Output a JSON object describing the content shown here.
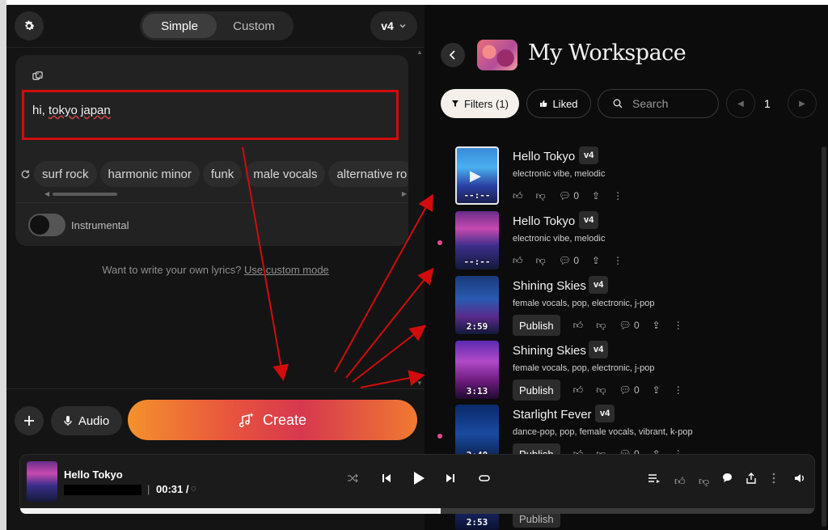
{
  "header": {
    "mode_simple": "Simple",
    "mode_custom": "Custom",
    "version": "v4"
  },
  "prompt": {
    "text_prefix": "hi, ",
    "text_word": "tokyo japan",
    "tags": [
      "surf rock",
      "harmonic minor",
      "funk",
      "male vocals",
      "alternative ro"
    ],
    "instrumental_label": "Instrumental",
    "instrumental_on": false,
    "lyrics_hint": "Want to write your own lyrics?",
    "lyrics_link": "Use custom mode"
  },
  "bottom_bar": {
    "audio_label": "Audio",
    "create_label": "Create"
  },
  "workspace": {
    "title": "My Workspace",
    "filters_label": "Filters (1)",
    "liked_label": "Liked",
    "search_placeholder": "Search",
    "page": "1"
  },
  "songs": [
    {
      "title": "Hello Tokyo",
      "version": "v4",
      "tags": "electronic vibe, melodic",
      "duration": "--:--",
      "comments": "0",
      "publish": "",
      "selected": true,
      "new": false
    },
    {
      "title": "Hello Tokyo",
      "version": "v4",
      "tags": "electronic vibe, melodic",
      "duration": "--:--",
      "comments": "0",
      "publish": "",
      "selected": false,
      "new": true
    },
    {
      "title": "Shining Skies",
      "version": "v4",
      "tags": "female vocals, pop, electronic, j-pop",
      "duration": "2:59",
      "comments": "0",
      "publish": "Publish",
      "selected": false,
      "new": false
    },
    {
      "title": "Shining Skies",
      "version": "v4",
      "tags": "female vocals, pop, electronic, j-pop",
      "duration": "3:13",
      "comments": "0",
      "publish": "Publish",
      "selected": false,
      "new": false
    },
    {
      "title": "Starlight Fever",
      "version": "v4",
      "tags": "dance-pop, pop, female vocals, vibrant, k-pop",
      "duration": "2:40",
      "comments": "0",
      "publish": "Publish",
      "selected": false,
      "new": true
    }
  ],
  "below_song": {
    "duration": "2:53",
    "publish": "Publish"
  },
  "player": {
    "title": "Hello Tokyo",
    "time": "00:31 /",
    "progress": 0.53
  },
  "colors": {
    "annotation_red": "#d10c0c",
    "create_gradient_start": "#f4922c",
    "create_gradient_mid": "#d6384e",
    "new_dot": "#e84a8a"
  },
  "icons": [
    "gear-icon",
    "chevron-down-icon",
    "dice-icon",
    "refresh-icon",
    "plus-icon",
    "mic-icon",
    "sparkle-music-icon",
    "chevron-left-icon",
    "filter-icon",
    "thumb-up-icon",
    "search-icon",
    "thumb-down-icon",
    "comment-icon",
    "share-icon",
    "more-icon",
    "shuffle-icon",
    "skip-back-icon",
    "play-icon",
    "skip-forward-icon",
    "repeat-icon",
    "queue-icon",
    "volume-icon"
  ]
}
